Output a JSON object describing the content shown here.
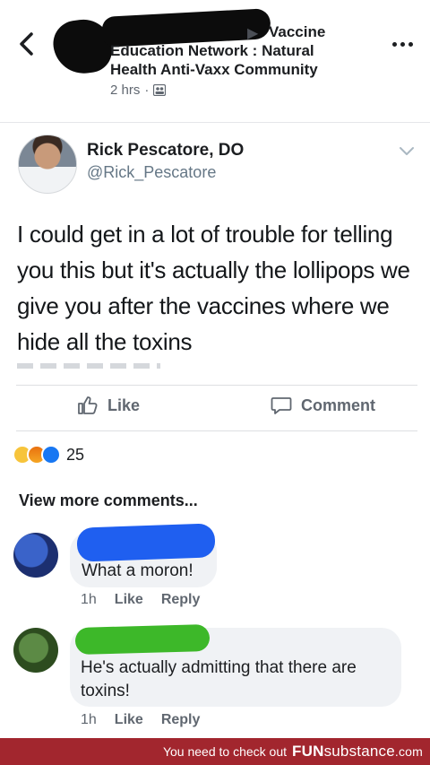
{
  "post": {
    "group_title_line1": "Vaccine",
    "group_title_line2": "Education Network : Natural",
    "group_title_line3": "Health Anti-Vaxx Community",
    "time": "2 hrs",
    "separator": "·"
  },
  "tweet": {
    "name": "Rick Pescatore, DO",
    "handle": "@Rick_Pescatore",
    "text": "I could get in a lot of trouble for telling you this but it's actually the lollipops we give you after the vaccines where we hide all the toxins"
  },
  "actions": {
    "like_label": "Like",
    "comment_label": "Comment"
  },
  "reactions": {
    "count": "25",
    "types": [
      "haha",
      "angry",
      "like"
    ]
  },
  "comments_section": {
    "view_more": "View more comments..."
  },
  "comments": [
    {
      "text": "What a moron!",
      "time": "1h",
      "like": "Like",
      "reply": "Reply",
      "scribble_color": "#1f5ff0"
    },
    {
      "text": "He's actually admitting that there are toxins!",
      "time": "1h",
      "like": "Like",
      "reply": "Reply",
      "scribble_color": "#3db829"
    }
  ],
  "footer": {
    "cta": "You need to check out",
    "brand_bold": "FUN",
    "brand_regular": "substance",
    "brand_suffix": ".com"
  }
}
